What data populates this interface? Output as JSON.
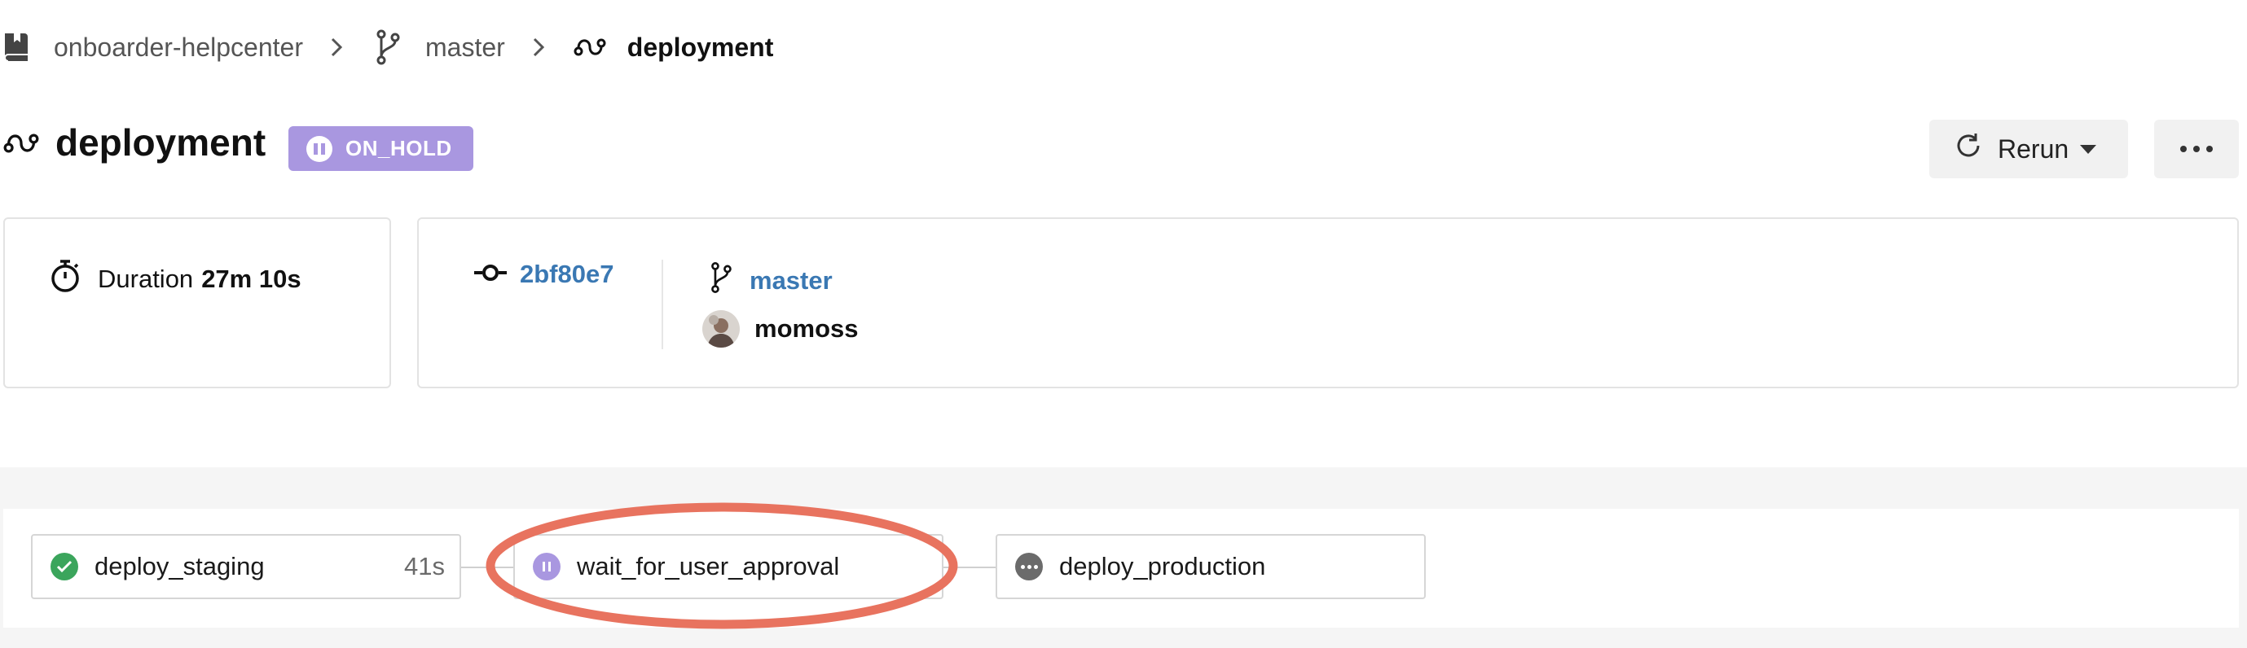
{
  "breadcrumb": {
    "project": "onboarder-helpcenter",
    "branch": "master",
    "workflow": "deployment"
  },
  "header": {
    "title": "deployment",
    "status": "ON_HOLD",
    "rerun_label": "Rerun"
  },
  "summary": {
    "duration_label": "Duration",
    "duration_value": "27m 10s",
    "commit_hash": "2bf80e7",
    "branch": "master",
    "user": "momoss"
  },
  "jobs": [
    {
      "name": "deploy_staging",
      "duration": "41s",
      "status": "success"
    },
    {
      "name": "wait_for_user_approval",
      "status": "on_hold"
    },
    {
      "name": "deploy_production",
      "status": "pending"
    }
  ],
  "colors": {
    "on_hold": "#a997e0",
    "success": "#3ba55c",
    "pending": "#6b6b6b",
    "link": "#3a78b3",
    "highlight": "#e8735f"
  },
  "icons": {
    "project": "book-icon",
    "branch": "git-branch-icon",
    "workflow": "workflow-icon",
    "duration": "stopwatch-icon",
    "commit": "git-commit-icon",
    "rerun": "refresh-icon",
    "more": "ellipsis-icon"
  }
}
